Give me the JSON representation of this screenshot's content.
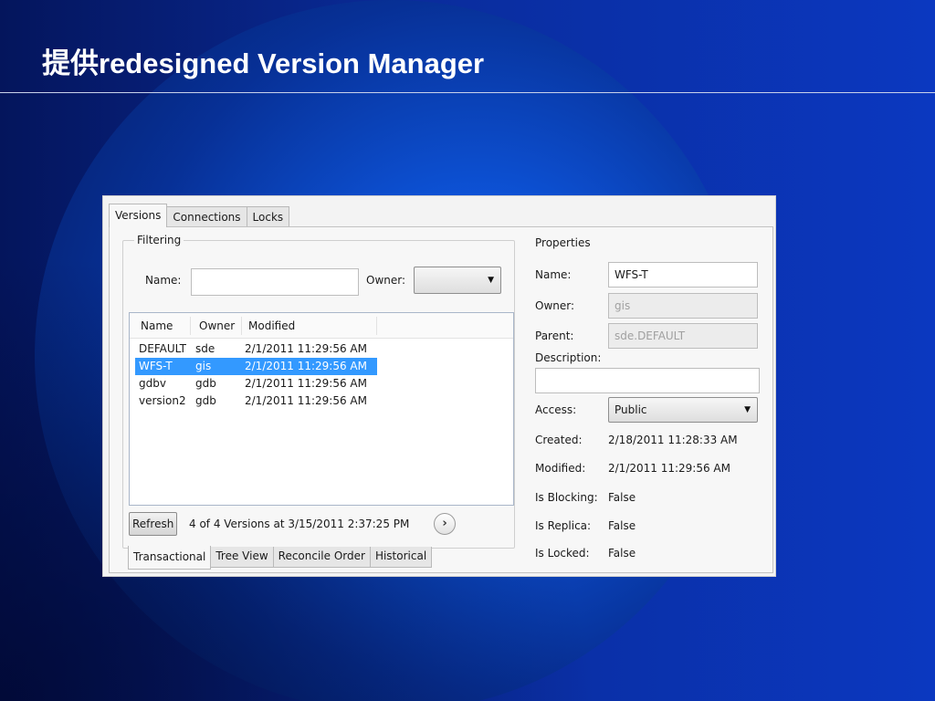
{
  "slide": {
    "title": "提供redesigned Version Manager"
  },
  "window": {
    "top_tabs": [
      "Versions",
      "Connections",
      "Locks"
    ],
    "filtering": {
      "group_title": "Filtering",
      "name_label": "Name:",
      "name_value": "",
      "owner_label": "Owner:",
      "owner_value": ""
    },
    "list": {
      "columns": [
        "Name",
        "Owner",
        "Modified"
      ],
      "rows": [
        {
          "name": "DEFAULT",
          "owner": "sde",
          "modified": "2/1/2011 11:29:56 AM",
          "selected": false
        },
        {
          "name": "WFS-T",
          "owner": "gis",
          "modified": "2/1/2011 11:29:56 AM",
          "selected": true
        },
        {
          "name": "gdbv",
          "owner": "gdb",
          "modified": "2/1/2011 11:29:56 AM",
          "selected": false
        },
        {
          "name": "version2",
          "owner": "gdb",
          "modified": "2/1/2011 11:29:56 AM",
          "selected": false
        }
      ]
    },
    "refresh_label": "Refresh",
    "status_text": "4 of 4 Versions at 3/15/2011 2:37:25 PM",
    "bottom_tabs": [
      "Transactional",
      "Tree View",
      "Reconcile Order",
      "Historical"
    ],
    "properties": {
      "title": "Properties",
      "name_label": "Name:",
      "name_value": "WFS-T",
      "owner_label": "Owner:",
      "owner_value": "gis",
      "parent_label": "Parent:",
      "parent_value": "sde.DEFAULT",
      "description_label": "Description:",
      "description_value": "",
      "access_label": "Access:",
      "access_value": "Public",
      "created_label": "Created:",
      "created_value": "2/18/2011 11:28:33 AM",
      "modified_label": "Modified:",
      "modified_value": "2/1/2011 11:29:56 AM",
      "blocking_label": "Is Blocking:",
      "blocking_value": "False",
      "replica_label": "Is Replica:",
      "replica_value": "False",
      "locked_label": "Is Locked:",
      "locked_value": "False"
    }
  },
  "icons": {
    "dropdown": "chevron-down-icon",
    "next": "chevron-right-icon"
  },
  "colors": {
    "selection": "#3399ff",
    "slide_background": "#0a2a9a"
  }
}
